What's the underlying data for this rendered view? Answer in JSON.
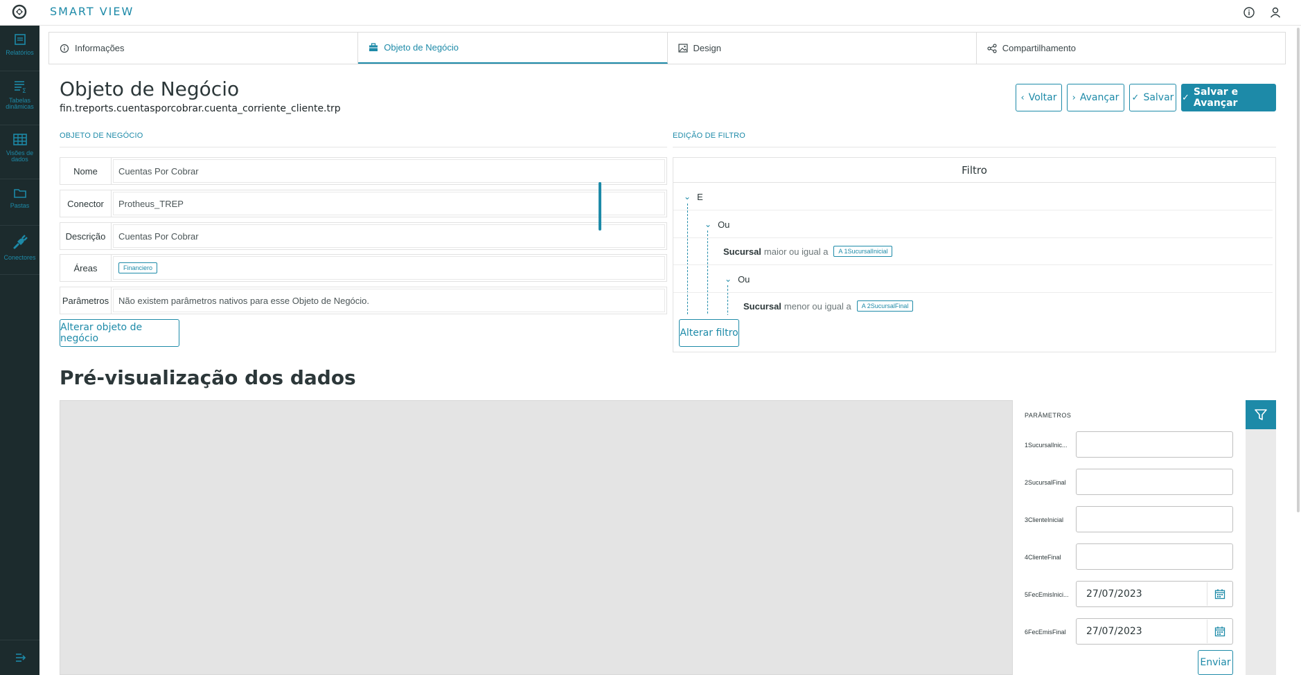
{
  "app": {
    "title": "SMART VIEW"
  },
  "sidebar": {
    "items": [
      {
        "label": "Relatórios",
        "icon": "report-icon"
      },
      {
        "label": "Tabelas dinâmicas",
        "icon": "pivot-table-icon"
      },
      {
        "label": "Visões de dados",
        "icon": "data-grid-icon"
      },
      {
        "label": "Pastas",
        "icon": "folder-icon"
      },
      {
        "label": "Conectores",
        "icon": "plug-icon"
      }
    ]
  },
  "tabs": [
    {
      "label": "Informações",
      "icon": "info-icon",
      "active": false
    },
    {
      "label": "Objeto de Negócio",
      "icon": "briefcase-icon",
      "active": true
    },
    {
      "label": "Design",
      "icon": "image-icon",
      "active": false
    },
    {
      "label": "Compartilhamento",
      "icon": "share-icon",
      "active": false
    }
  ],
  "header": {
    "title": "Objeto de Negócio",
    "subtitle": "fin.treports.cuentasporcobrar.cuenta_corriente_cliente.trp"
  },
  "actions": {
    "back": "Voltar",
    "next": "Avançar",
    "save": "Salvar",
    "save_next": "Salvar e Avançar"
  },
  "business_object": {
    "section_label": "OBJETO DE NEGÓCIO",
    "rows": [
      {
        "key": "Nome",
        "value": "Cuentas Por Cobrar"
      },
      {
        "key": "Conector",
        "value": "Protheus_TREP"
      },
      {
        "key": "Descrição",
        "value": "Cuentas Por Cobrar"
      },
      {
        "key": "Áreas",
        "tag": "Financiero"
      },
      {
        "key": "Parâmetros",
        "value": "Não existem parâmetros nativos para esse Objeto de Negócio."
      }
    ],
    "change_button": "Alterar objeto de negócio"
  },
  "filter": {
    "section_label": "EDIÇÃO DE FILTRO",
    "header": "Filtro",
    "tree": {
      "root": "E",
      "or1": "Ou",
      "cond1": {
        "field": "Sucursal",
        "op": "maior ou igual a",
        "param": "1SucursalInicial"
      },
      "or2": "Ou",
      "cond2": {
        "field": "Sucursal",
        "op": "menor ou igual a",
        "param": "2SucursalFinal"
      }
    },
    "change_button": "Alterar filtro"
  },
  "preview": {
    "title": "Pré-visualização dos dados",
    "params_label": "PARÂMETROS",
    "params": [
      {
        "label": "1SucursalInic...",
        "value": ""
      },
      {
        "label": "2SucursalFinal",
        "value": ""
      },
      {
        "label": "3ClienteInicial",
        "value": ""
      },
      {
        "label": "4ClienteFinal",
        "value": ""
      },
      {
        "label": "5FecEmisInici...",
        "value": "27/07/2023"
      },
      {
        "label": "6FecEmisFinal",
        "value": "27/07/2023"
      }
    ],
    "send_button": "Enviar"
  },
  "colors": {
    "accent": "#1d8aa8",
    "sidebar": "#1c2b2d",
    "preview_bg": "#e4e4e4"
  }
}
